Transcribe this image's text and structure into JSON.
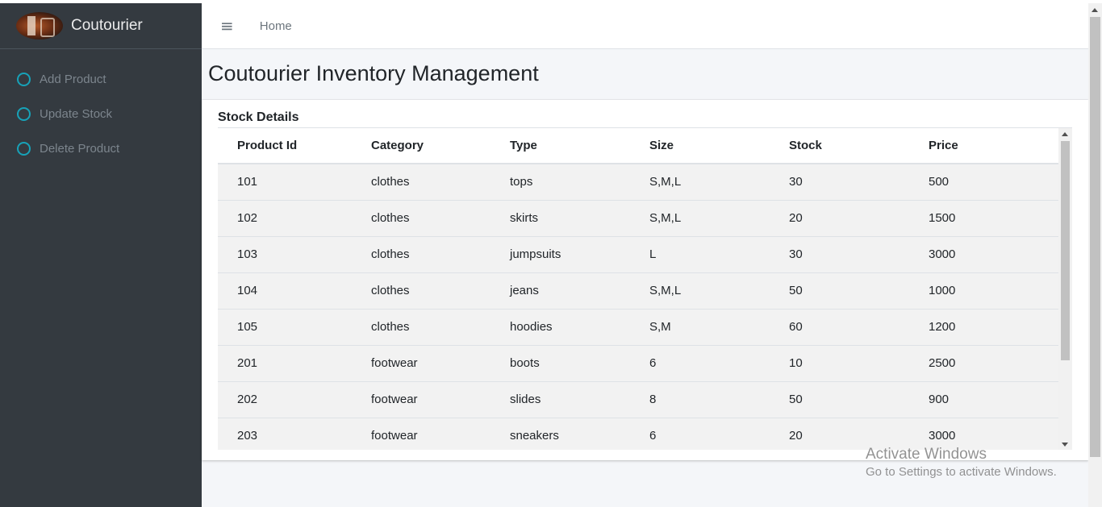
{
  "sidebar": {
    "brand": "Coutourier",
    "items": [
      {
        "label": "Add Product",
        "icon": "circle-icon"
      },
      {
        "label": "Update Stock",
        "icon": "circle-icon"
      },
      {
        "label": "Delete Product",
        "icon": "circle-icon"
      }
    ]
  },
  "header": {
    "menu_icon": "≡",
    "home_label": "Home"
  },
  "main": {
    "title": "Coutourier Inventory Management",
    "card_title": "Stock Details",
    "table": {
      "columns": [
        "Product Id",
        "Category",
        "Type",
        "Size",
        "Stock",
        "Price"
      ],
      "rows": [
        [
          "101",
          "clothes",
          "tops",
          "S,M,L",
          "30",
          "500"
        ],
        [
          "102",
          "clothes",
          "skirts",
          "S,M,L",
          "20",
          "1500"
        ],
        [
          "103",
          "clothes",
          "jumpsuits",
          "L",
          "30",
          "3000"
        ],
        [
          "104",
          "clothes",
          "jeans",
          "S,M,L",
          "50",
          "1000"
        ],
        [
          "105",
          "clothes",
          "hoodies",
          "S,M",
          "60",
          "1200"
        ],
        [
          "201",
          "footwear",
          "boots",
          "6",
          "10",
          "2500"
        ],
        [
          "202",
          "footwear",
          "slides",
          "8",
          "50",
          "900"
        ],
        [
          "203",
          "footwear",
          "sneakers",
          "6",
          "20",
          "3000"
        ]
      ]
    }
  },
  "watermark": {
    "line1": "Activate Windows",
    "line2": "Go to Settings to activate Windows."
  },
  "colors": {
    "sidebar_bg": "#343a40",
    "accent": "#17a2b8",
    "row_bg": "#f2f2f2"
  }
}
